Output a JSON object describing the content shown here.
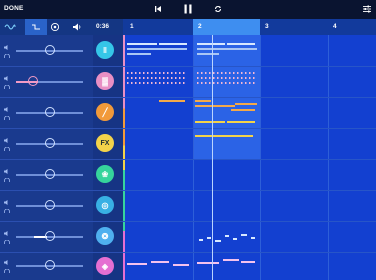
{
  "topbar": {
    "done_label": "DONE",
    "icons": [
      "skip-back-icon",
      "pause-icon",
      "loop-icon",
      "mixer-settings-icon"
    ]
  },
  "subbar": {
    "mode_icons": [
      "waveform-icon",
      "automation-icon",
      "tempo-icon",
      "volume-icon"
    ],
    "time": "0:36",
    "bars": [
      "1",
      "2",
      "3",
      "4"
    ]
  },
  "tracks": [
    {
      "name": "drums",
      "icon": "drum-machine-icon",
      "color": "#35c6e8",
      "glyph": "‖"
    },
    {
      "name": "synth-pad",
      "icon": "synth-pad-icon",
      "color": "#e88fc4",
      "glyph": "▓"
    },
    {
      "name": "bass",
      "icon": "bass-synth-icon",
      "color": "#f29a3a",
      "glyph": "╱"
    },
    {
      "name": "fx",
      "icon": "fx-icon",
      "color": "#f3d34a",
      "glyph": "FX"
    },
    {
      "name": "butterfly",
      "icon": "butterfly-icon",
      "color": "#36d49c",
      "glyph": "❀"
    },
    {
      "name": "globe",
      "icon": "globe-synth-icon",
      "color": "#38b0e4",
      "glyph": "◎"
    },
    {
      "name": "vortex",
      "icon": "vortex-synth-icon",
      "color": "#4fb0ef",
      "glyph": "❂"
    },
    {
      "name": "diamond",
      "icon": "diamond-synth-icon",
      "color": "#e56fd2",
      "glyph": "◈"
    }
  ],
  "colors": {
    "accent_orange": "#f3a94a",
    "accent_pink": "#f29bc5",
    "playhead": "#b9d4ff"
  }
}
